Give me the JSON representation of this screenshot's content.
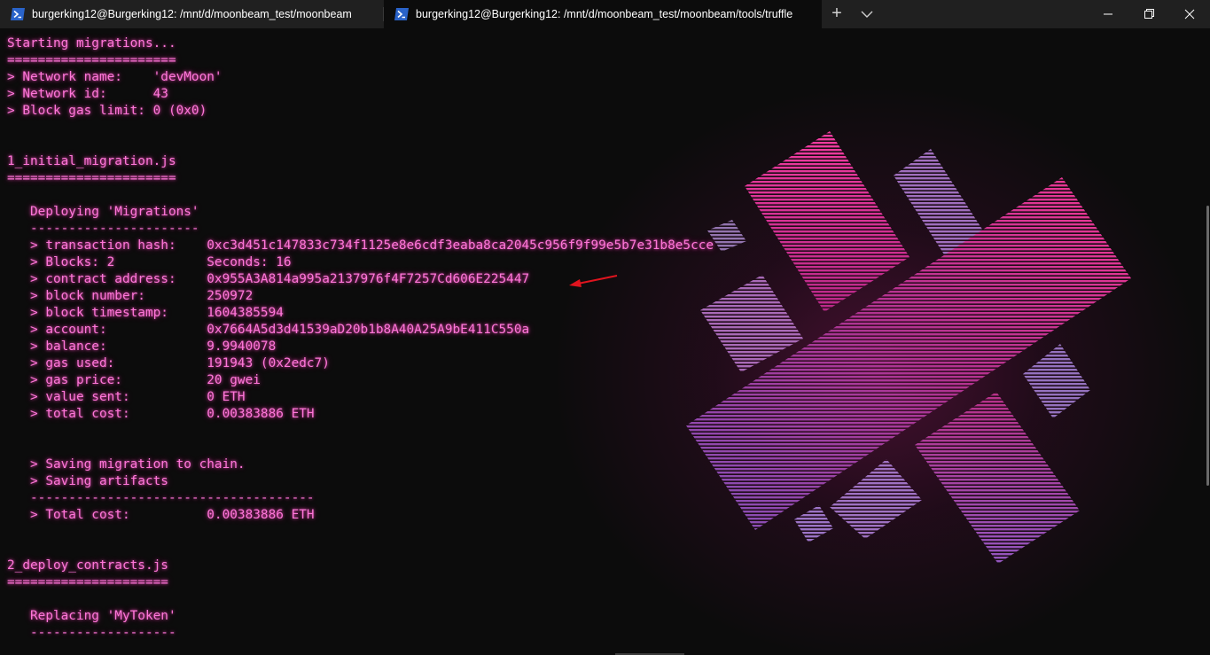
{
  "tabs": [
    {
      "title": "burgerking12@Burgerking12: /mnt/d/moonbeam_test/moonbeam",
      "icon": "powershell-icon",
      "active": false
    },
    {
      "title": "burgerking12@Burgerking12: /mnt/d/moonbeam_test/moonbeam/tools/truffle",
      "icon": "powershell-icon",
      "active": true
    }
  ],
  "tabbar": {
    "new_tab_label": "+",
    "dropdown_icon": "chevron-down-icon"
  },
  "window_controls": [
    "minimize-icon",
    "maximize-icon",
    "close-icon"
  ],
  "colors": {
    "terminal_text": "#ff77d9",
    "terminal_bg": "#0c0c0c",
    "titlebar_bg": "#202020",
    "annotation_arrow": "#e0141e"
  },
  "background_image": "x-shaped-striped-logo",
  "annotation": {
    "type": "red-arrow",
    "points_to": "contract address"
  },
  "terminal": {
    "lines": [
      "Starting migrations...",
      "======================",
      "> Network name:    'devMoon'",
      "> Network id:      43",
      "> Block gas limit: 0 (0x0)",
      "",
      "",
      "1_initial_migration.js",
      "======================",
      "",
      "   Deploying 'Migrations'",
      "   ----------------------",
      "   > transaction hash:    0xc3d451c147833c734f1125e8e6cdf3eaba8ca2045c956f9f99e5b7e31b8e5cce",
      "   > Blocks: 2            Seconds: 16",
      "   > contract address:    0x955A3A814a995a2137976f4F7257Cd606E225447",
      "   > block number:        250972",
      "   > block timestamp:     1604385594",
      "   > account:             0x7664A5d3d41539aD20b1b8A40A25A9bE411C550a",
      "   > balance:             9.9940078",
      "   > gas used:            191943 (0x2edc7)",
      "   > gas price:           20 gwei",
      "   > value sent:          0 ETH",
      "   > total cost:          0.00383886 ETH",
      "",
      "",
      "   > Saving migration to chain.",
      "   > Saving artifacts",
      "   -------------------------------------",
      "   > Total cost:          0.00383886 ETH",
      "",
      "",
      "2_deploy_contracts.js",
      "=====================",
      "",
      "   Replacing 'MyToken'",
      "   -------------------"
    ]
  }
}
